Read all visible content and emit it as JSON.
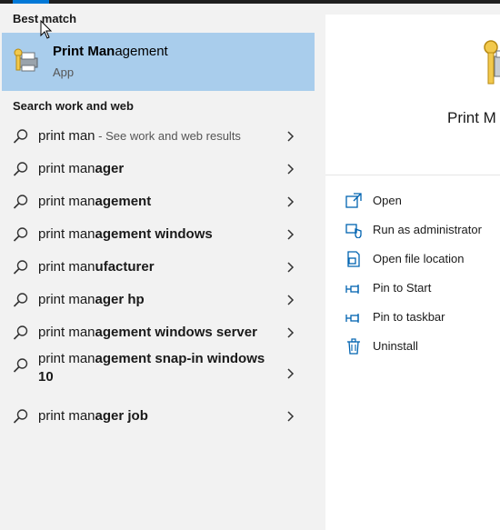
{
  "left_pane": {
    "best_match_label": "Best match",
    "best_match": {
      "title_bold": "Print Man",
      "title_rest": "agement",
      "subtitle": "App",
      "icon": "print-management-icon"
    },
    "search_section_label": "Search work and web",
    "suggestions": [
      {
        "bold": "",
        "plain": "print man",
        "hint": " - See work and web results"
      },
      {
        "plain": "print man",
        "bold": "ager"
      },
      {
        "plain": "print man",
        "bold": "agement"
      },
      {
        "plain": "print man",
        "bold": "agement windows"
      },
      {
        "plain": "print man",
        "bold": "ufacturer"
      },
      {
        "plain": "print man",
        "bold": "ager hp"
      },
      {
        "plain": "print man",
        "bold": "agement windows server"
      },
      {
        "plain": "print man",
        "bold": "agement snap-in windows 10"
      },
      {
        "plain": "print man",
        "bold": "ager job"
      }
    ]
  },
  "right_pane": {
    "title": "Print M",
    "actions": [
      {
        "label": "Open",
        "icon": "open-icon"
      },
      {
        "label": "Run as administrator",
        "icon": "shield-icon"
      },
      {
        "label": "Open file location",
        "icon": "file-location-icon"
      },
      {
        "label": "Pin to Start",
        "icon": "pin-icon"
      },
      {
        "label": "Pin to taskbar",
        "icon": "pin-taskbar-icon"
      },
      {
        "label": "Uninstall",
        "icon": "trash-icon"
      }
    ]
  },
  "colors": {
    "selected": "#a9cdec",
    "accent": "#0078d7",
    "icon_blue": "#0063b1"
  }
}
